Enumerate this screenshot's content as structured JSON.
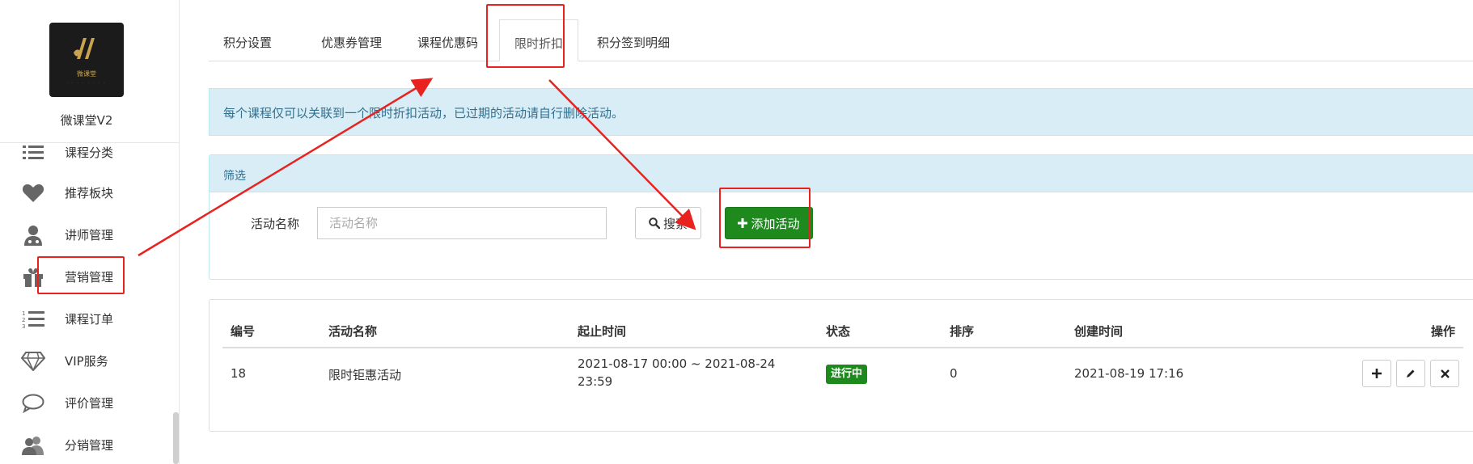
{
  "sidebar": {
    "logo_text": "微课堂",
    "site_name": "微课堂V2",
    "items": [
      {
        "label": "课程分类",
        "icon": "list-icon"
      },
      {
        "label": "推荐板块",
        "icon": "heart-icon"
      },
      {
        "label": "讲师管理",
        "icon": "doctor-icon"
      },
      {
        "label": "营销管理",
        "icon": "gift-icon"
      },
      {
        "label": "课程订单",
        "icon": "ordered-list-icon"
      },
      {
        "label": "VIP服务",
        "icon": "diamond-icon"
      },
      {
        "label": "评价管理",
        "icon": "comment-icon"
      },
      {
        "label": "分销管理",
        "icon": "users-icon"
      }
    ]
  },
  "tabs": [
    {
      "label": "积分设置"
    },
    {
      "label": "优惠券管理"
    },
    {
      "label": "课程优惠码"
    },
    {
      "label": "限时折扣",
      "active": true
    },
    {
      "label": "积分签到明细"
    }
  ],
  "alert": {
    "text": "每个课程仅可以关联到一个限时折扣活动，已过期的活动请自行删除活动。"
  },
  "filter": {
    "title": "筛选",
    "label": "活动名称",
    "placeholder": "活动名称",
    "search_label": "搜索",
    "add_label": "添加活动"
  },
  "table": {
    "headers": [
      "编号",
      "活动名称",
      "起止时间",
      "状态",
      "排序",
      "创建时间",
      "操作"
    ],
    "rows": [
      {
        "id": "18",
        "name": "限时钜惠活动",
        "period_line1": "2021-08-17 00:00 ~ 2021-08-24",
        "period_line2": "23:59",
        "status": "进行中",
        "sort": "0",
        "created": "2021-08-19 17:16"
      }
    ]
  },
  "colors": {
    "accent_green": "#1e8a1e",
    "annotation_red": "#e8231f",
    "alert_bg": "#d9edf7",
    "alert_text": "#31708f"
  }
}
